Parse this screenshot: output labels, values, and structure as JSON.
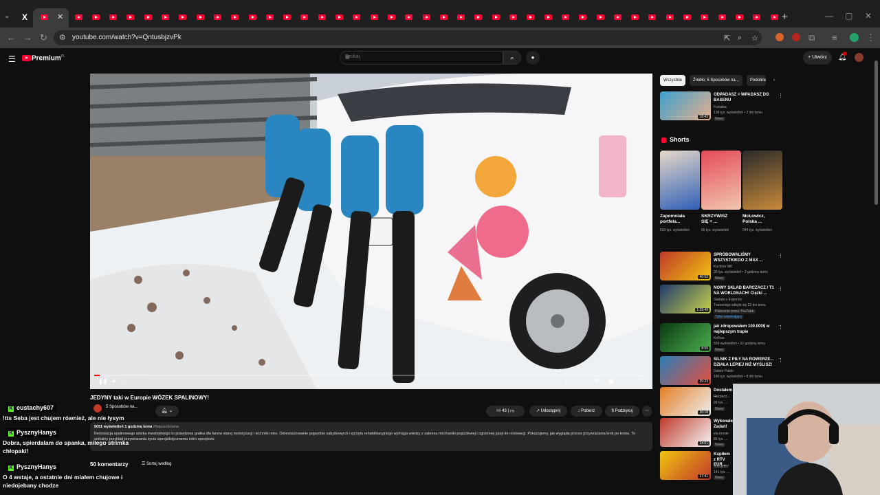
{
  "browser": {
    "url": "youtube.com/watch?v=QntusbjzvPk",
    "new_tab": "+",
    "close_tab": "✕",
    "x_tab": "X"
  },
  "youtube": {
    "brand": "Premium",
    "brand_region": "PL",
    "search_placeholder": "Szukaj",
    "create_label": "Utwórz"
  },
  "player": {
    "time": "0:02 / 15:38",
    "progress": 0.01
  },
  "video": {
    "title": "JEDYNY taki w Europie WÓZEK SPALINOWY!",
    "channel": "5 Sposobów na...",
    "likes": "43",
    "share": "Udostępnij",
    "download": "Pobierz",
    "thanks": "Podziękuj",
    "views_date": "5051 wyświetleń  1 godzinę temu",
    "hashtag": "#5sposobowna",
    "description": "Renowacja spalinowego wózka inwalidzkiego to prawdziwa gratka dla fanów starej motoryzacji i techniki retro. Odrestaurowanie pojazdów zabytkowych i sprzętu rehabilitacyjnego wymaga wiedzy z zakresu mechaniki pojazdowej i ogromnej pasji do renowacji. Pokazujemy, jak wygląda proces przywracania krok po kroku. To unikalny przykład przywracania życia specjalistycznemu retro sprzętowi.",
    "comments_count": "50 komentarzy",
    "sort_by": "Sortuj według"
  },
  "sidebar": {
    "chips": [
      "Wszystkie",
      "Źródło: 5 Sposobów na...",
      "Podobne"
    ],
    "shorts_heading": "Shorts",
    "top_video": {
      "title": "ODPADASZ = WPADASZ DO BASENU",
      "channel": "Fusialka",
      "meta": "138 tys. wyświetleń  •  2 dni temu",
      "badge": "Nowy",
      "duration": "18:43"
    },
    "shorts": [
      {
        "title": "Zapomniała portfela...",
        "views": "533 tys. wyświetleń"
      },
      {
        "title": "SKRZYWISZ SIĘ = ...",
        "views": "65 tys. wyświetleń"
      },
      {
        "title": "McŁowicz, Polska ...",
        "views": "944 tys. wyświetleń"
      }
    ],
    "videos": [
      {
        "title": "SPRÓBOWALIŚMY WSZYSTKIEGO Z MAX ...",
        "channel": "Kuchnia WK",
        "meta": "30 tys. wyświetleń  •  3 godziny temu",
        "badge": "Nowy",
        "duration": "40:52"
      },
      {
        "title": "NOWY SKŁAD BARCZACZ / T1 NA WORLDSACH! Ciężki ...",
        "channel": "Gaduła o Esporcie",
        "meta": "Transmisja odbyła się 12 dni temu",
        "badge": "Polecenie przez YouTube",
        "badge2": "Tylko wspierający",
        "duration": "1:29:49"
      },
      {
        "title": "jak zdropowałem 100.000$ w najlepszym trapie",
        "channel": "Kefirus",
        "meta": "559 wyświetleń  •  22 godziny temu",
        "badge": "Nowy",
        "duration": "8:55"
      },
      {
        "title": "SILNIK Z PIŁY NA ROWERZE... DZIAŁA LEPIEJ NIŻ MYŚLISZ!",
        "channel": "Doktor Pablo",
        "meta": "180 tys. wyświetleń  •  8 dni temu",
        "badge": "",
        "duration": "25:23"
      },
      {
        "title": "Dostałem ...",
        "channel": "Rozpacz...",
        "meta": "93 tys. ...",
        "badge": "Nowy",
        "duration": "20:18"
      },
      {
        "title": "Wykonałem Zadań!",
        "channel": "ełu monte",
        "meta": "85 tys. ...",
        "badge": "Nowy",
        "duration": "24:01"
      },
      {
        "title": "Kupiłem z RTV EUR...",
        "channel": "testujeMY",
        "meta": "141 tys. ...",
        "badge": "Nowy",
        "duration": "27:41"
      }
    ]
  },
  "chat": [
    {
      "user": "eustachy607",
      "message": "!tts Seba jest chujem również, ale nie łysym"
    },
    {
      "user": "PysznyHanys",
      "message": "Dobra, spierdalam do spanka, miłego strimka chłopaki!"
    },
    {
      "user": "PysznyHanys",
      "message": "O 4 wstaje, a ostatnie dni miałem chujowe i niedojebany chodze"
    }
  ],
  "colors": {
    "accent": "#ff0033",
    "kick": "#53fc18",
    "chip_active": "#f1f1f1"
  }
}
